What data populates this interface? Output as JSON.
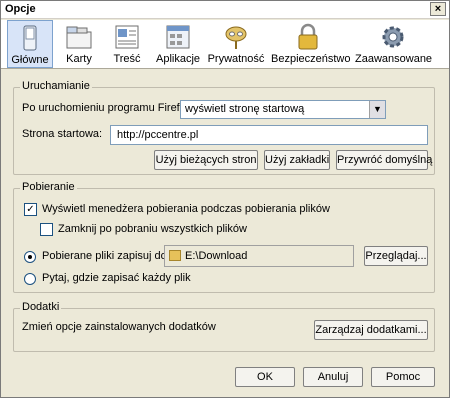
{
  "window": {
    "title": "Opcje",
    "close_glyph": "×"
  },
  "tabs": [
    {
      "label": "Główne",
      "icon": "switch-icon",
      "selected": true
    },
    {
      "label": "Karty",
      "icon": "tabs-icon",
      "selected": false
    },
    {
      "label": "Treść",
      "icon": "content-icon",
      "selected": false
    },
    {
      "label": "Aplikacje",
      "icon": "applications-icon",
      "selected": false
    },
    {
      "label": "Prywatność",
      "icon": "mask-icon",
      "selected": false
    },
    {
      "label": "Bezpieczeństwo",
      "icon": "lock-icon",
      "selected": false
    },
    {
      "label": "Zaawansowane",
      "icon": "gear-icon",
      "selected": false
    }
  ],
  "startup": {
    "section_title": "Uruchamianie",
    "on_start_label": "Po uruchomieniu programu Firefox:",
    "on_start_value": "wyświetl stronę startową",
    "homepage_label": "Strona startowa:",
    "homepage_value": "http://pccentre.pl",
    "use_current_button": "Użyj bieżących stron",
    "use_bookmark_button": "Użyj zakładki",
    "restore_default_button": "Przywróć domyślną"
  },
  "downloads": {
    "section_title": "Pobieranie",
    "show_manager_label": "Wyświetl menedżera pobierania podczas pobierania plików",
    "show_manager_checked": true,
    "close_when_done_label": "Zamknij po pobraniu wszystkich plików",
    "close_when_done_checked": false,
    "save_to_label": "Pobierane pliki zapisuj do:",
    "save_to_selected": true,
    "save_to_path": "E:\\Download",
    "browse_button": "Przeglądaj...",
    "always_ask_label": "Pytaj, gdzie zapisać każdy plik",
    "always_ask_selected": false
  },
  "addons": {
    "section_title": "Dodatki",
    "description": "Zmień opcje zainstalowanych dodatków",
    "manage_button": "Zarządzaj dodatkami..."
  },
  "footer": {
    "ok_button": "OK",
    "cancel_button": "Anuluj",
    "help_button": "Pomoc"
  }
}
